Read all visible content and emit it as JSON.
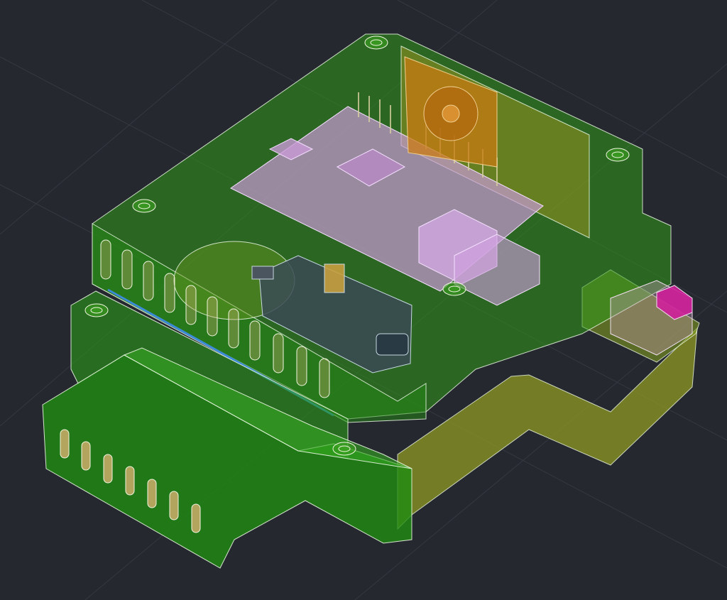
{
  "viewport": {
    "kind": "3D CAD model viewport",
    "colors": {
      "background": "#262830",
      "grid": "#353841",
      "enclosure_green": "#2f9a1a",
      "base_olive": "#8f9a22",
      "board_pink": "#c99ad6",
      "fan_orange": "#c87a12",
      "camera_dark": "#3a4a55",
      "connector_magenta": "#d0209a",
      "edge_white": "#e8f5e0",
      "accent_blue": "#3a8ad8"
    }
  }
}
